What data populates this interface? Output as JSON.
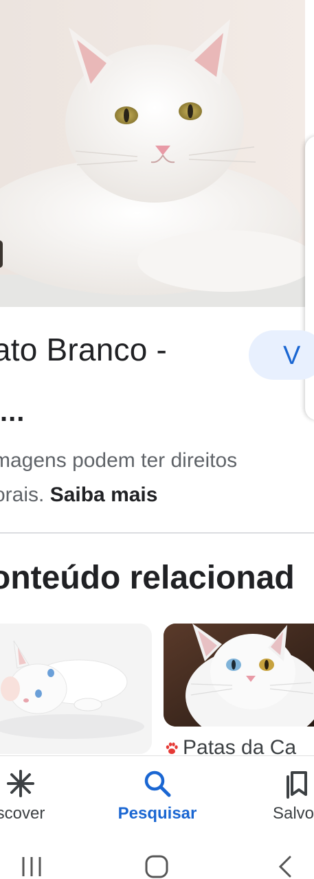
{
  "colors": {
    "accent": "#1a66d2",
    "accent_bg": "#e8f0fe",
    "text_primary": "#202124",
    "text_secondary": "#5f6368",
    "divider": "#dadce0",
    "paw_icon": "#e53935"
  },
  "result": {
    "title": "ato Branco -",
    "title_continuation": "...",
    "visit_button_label": "V"
  },
  "notice": {
    "line1": "magens podem ter direitos",
    "line2_prefix": "orais. ",
    "learn_more_label": "Saiba mais"
  },
  "related": {
    "heading": "onteúdo relacionad",
    "cards": [
      {
        "source": ""
      },
      {
        "source": "Patas da Ca",
        "source_icon": "paw-icon"
      }
    ]
  },
  "bottom_nav": {
    "items": [
      {
        "label": "scover",
        "icon": "discover-asterisk-icon",
        "active": false
      },
      {
        "label": "Pesquisar",
        "icon": "search-icon",
        "active": true
      },
      {
        "label": "Salvos",
        "icon": "bookmarks-icon",
        "active": false
      }
    ]
  },
  "system_nav": {
    "buttons": [
      "recent-apps-icon",
      "home-icon",
      "back-icon"
    ]
  }
}
